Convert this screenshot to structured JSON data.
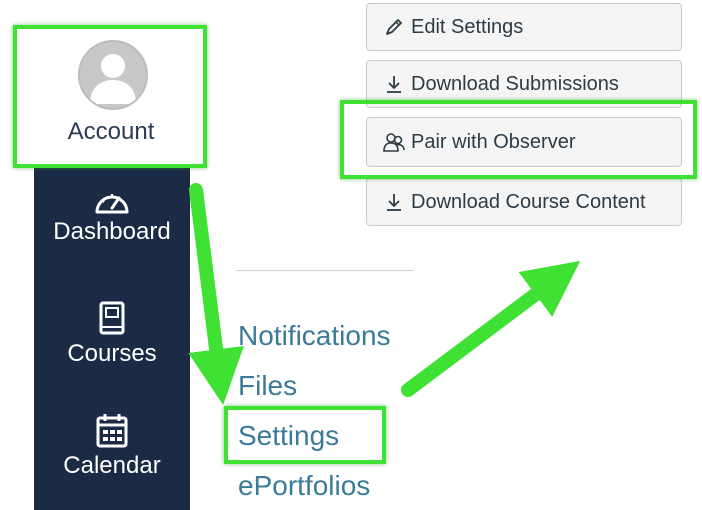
{
  "account": {
    "label": "Account",
    "avatar_icon": "user-avatar-icon"
  },
  "global_nav": {
    "items": [
      {
        "label": "Dashboard",
        "icon": "dashboard-gauge-icon"
      },
      {
        "label": "Courses",
        "icon": "book-icon"
      },
      {
        "label": "Calendar",
        "icon": "calendar-icon"
      }
    ]
  },
  "account_menu": {
    "links": [
      {
        "label": "Notifications"
      },
      {
        "label": "Files"
      },
      {
        "label": "Settings"
      },
      {
        "label": "ePortfolios"
      }
    ]
  },
  "settings_buttons": [
    {
      "label": "Edit Settings",
      "icon": "pencil-icon"
    },
    {
      "label": "Download Submissions",
      "icon": "download-icon"
    },
    {
      "label": "Pair with Observer",
      "icon": "observer-pair-icon"
    },
    {
      "label": "Download Course Content",
      "icon": "download-icon"
    }
  ],
  "colors": {
    "nav_background": "#1b2a45",
    "link": "#3a7a9a",
    "highlight": "#3fe233",
    "button_background": "#f5f5f5"
  }
}
